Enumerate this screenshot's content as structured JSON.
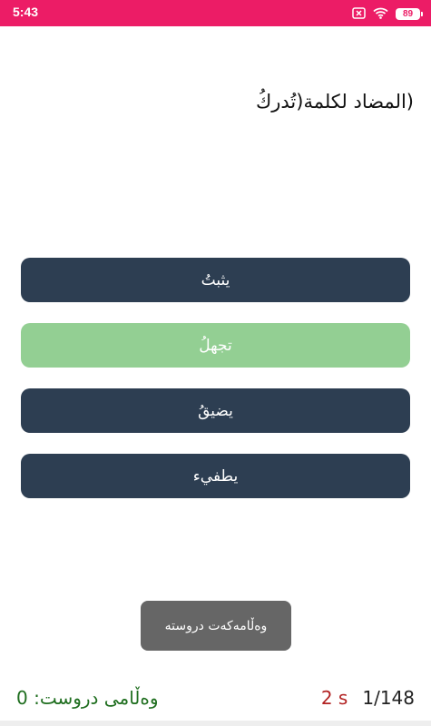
{
  "status_bar": {
    "time": "5:43",
    "battery": "89",
    "icons": [
      "close-box-icon",
      "wifi-icon",
      "battery-icon"
    ]
  },
  "question": {
    "text": "(المضاد لكلمة(تُدركُ"
  },
  "answers": [
    {
      "label": "يثبتُ",
      "state": "default"
    },
    {
      "label": "تجهلُ",
      "state": "correct"
    },
    {
      "label": "يضيقُ",
      "state": "default"
    },
    {
      "label": "يطفيء",
      "state": "default"
    }
  ],
  "toast": {
    "text": "وەڵامەکەت دروستە"
  },
  "footer": {
    "correct_count_text": "وەڵامی دروست: 0",
    "timer": "2 s",
    "progress": "1/148"
  },
  "colors": {
    "status_bar": "#ec1c66",
    "button": "#2d3e52",
    "correct_button": "#93cf93",
    "score_text": "#1f6e1f",
    "timer_text": "#b22222"
  }
}
